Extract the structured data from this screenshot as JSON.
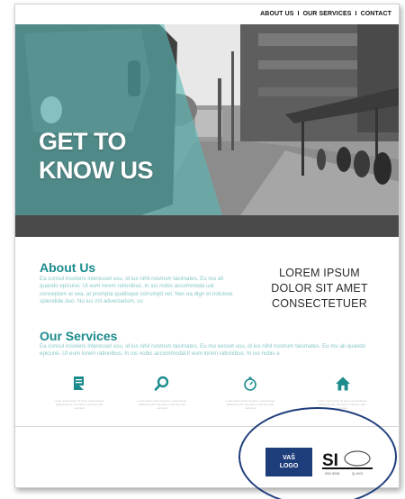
{
  "nav": {
    "items": [
      "ABOUT US",
      "OUR SERVICES",
      "CONTACT"
    ],
    "separator": "I"
  },
  "hero": {
    "title_line1": "GET TO",
    "title_line2": "KNOW US",
    "accent_color": "#5bb8b5"
  },
  "about": {
    "title": "About Us",
    "text": "Ea consul insolens interesset usu, id ius nihil nostrum tacimates. Eu mu ali quando epicurei. Ut eum lorem rationibus. In ius nobis accommoda uat conceptam ei sea, at prompta qualisque corrumpit vel. Nec ea dign et noluisse splendide duo. No ius zril adversarium, cu"
  },
  "lorem": {
    "line1": "LOREM IPSUM",
    "line2": "DOLOR SIT AMET",
    "line3": "CONSECTETUER"
  },
  "services": {
    "title": "Our Services",
    "text": "Ea consul insolens interesset usu, id ius nihil nostrum tacimates. Eu mu eesset usu, id ius nihil nostrum tacimates. Eu mu ali quando epicurei. Ut eum lorem rationibus. In ius nobis accommodaUt eum lorem rationibus. In ius nobis a",
    "icons": [
      {
        "name": "document-icon",
        "caption": "Lorem ipsum dolor sit amet, consectetuer adipiscing elit, sed diam nonummy nibh euismod"
      },
      {
        "name": "search-icon",
        "caption": "Lorem ipsum dolor sit amet, consectetuer adipiscing elit, sed diam nonummy nibh euismod"
      },
      {
        "name": "stopwatch-icon",
        "caption": "Lorem ipsum dolor sit amet, consectetuer adipiscing elit, sed diam nonummy nibh euismod"
      },
      {
        "name": "home-icon",
        "caption": "Lorem ipsum dolor sit amet, consectetuer adipiscing elit, sed diam nonummy nibh euismod"
      }
    ],
    "icon_color": "#1c8b8c"
  },
  "footer": {
    "logo_line1": "VAŠ",
    "logo_line2": "LOGO",
    "cert_text": "SI",
    "cert_sub1": "ISO 9001",
    "cert_sub2": "Q-XXX",
    "logo_color": "#1e3d7b"
  }
}
